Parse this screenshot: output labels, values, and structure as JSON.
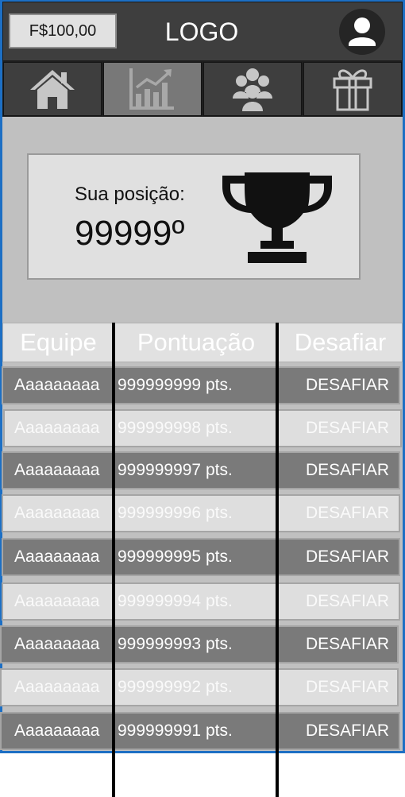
{
  "header": {
    "balance": "F$100,00",
    "logo": "LOGO"
  },
  "nav": {
    "tabs": [
      {
        "icon": "home-icon",
        "active": false
      },
      {
        "icon": "chart-icon",
        "active": true
      },
      {
        "icon": "group-icon",
        "active": false
      },
      {
        "icon": "gift-icon",
        "active": false
      }
    ]
  },
  "ranking": {
    "label": "Sua posição:",
    "position": "99999º"
  },
  "table": {
    "columns": [
      "Equipe",
      "Pontuação",
      "Desafiar"
    ],
    "rows": [
      {
        "team": "Aaaaaaaaa",
        "score": "999999999 pts.",
        "action": "DESAFIAR"
      },
      {
        "team": "Aaaaaaaaa",
        "score": "999999998 pts.",
        "action": "DESAFIAR"
      },
      {
        "team": "Aaaaaaaaa",
        "score": "999999997 pts.",
        "action": "DESAFIAR"
      },
      {
        "team": "Aaaaaaaaa",
        "score": "999999996 pts.",
        "action": "DESAFIAR"
      },
      {
        "team": "Aaaaaaaaa",
        "score": "999999995 pts.",
        "action": "DESAFIAR"
      },
      {
        "team": "Aaaaaaaaa",
        "score": "999999994 pts.",
        "action": "DESAFIAR"
      },
      {
        "team": "Aaaaaaaaa",
        "score": "999999993 pts.",
        "action": "DESAFIAR"
      },
      {
        "team": "Aaaaaaaaa",
        "score": "999999992 pts.",
        "action": "DESAFIAR"
      },
      {
        "team": "Aaaaaaaaa",
        "score": "999999991 pts.",
        "action": "DESAFIAR"
      }
    ]
  },
  "colors": {
    "header_bg": "#3e3e3e",
    "active_tab": "#787878",
    "frame_border": "#1d6fc4",
    "row_dark": "#7a7a7a",
    "row_light": "#dedede"
  }
}
